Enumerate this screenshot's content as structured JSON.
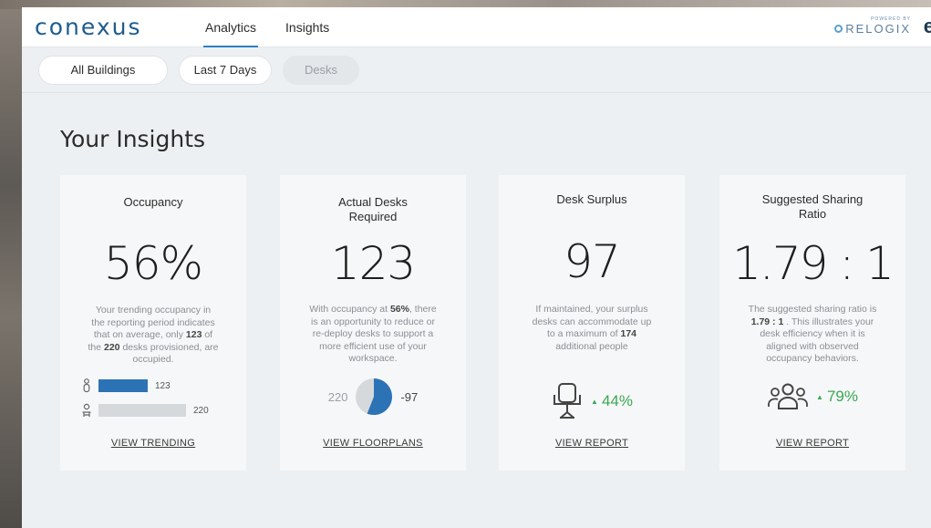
{
  "app": {
    "logo": "conexus",
    "nav": [
      {
        "label": "Analytics",
        "active": true
      },
      {
        "label": "Insights",
        "active": false
      }
    ],
    "powered_by": "POWERED BY",
    "brand": "RELOGIX",
    "edge_letter": "e"
  },
  "filters": [
    {
      "label": "All Buildings"
    },
    {
      "label": "Last 7 Days"
    },
    {
      "label": "Desks",
      "disabled": true
    }
  ],
  "page": {
    "title": "Your Insights"
  },
  "colors": {
    "accent": "#2f80c2",
    "bar_primary": "#2c73b6",
    "bar_secondary": "#d6d9dc",
    "positive": "#3aa853"
  },
  "cards": {
    "occupancy": {
      "title": "Occupancy",
      "value": "56%",
      "desc": [
        "Your trending occupancy in",
        "the reporting period indicates",
        "that on average, only ",
        "123",
        " of",
        "the ",
        "220",
        " desks provisioned, are",
        "occupied."
      ],
      "bars": [
        {
          "icon": "person-icon",
          "value": 123
        },
        {
          "icon": "desk-user-icon",
          "value": 220
        }
      ],
      "bar_max": 220,
      "link": "VIEW TRENDING"
    },
    "desks": {
      "title": [
        "Actual Desks",
        "Required"
      ],
      "value": "123",
      "desc": [
        "With occupancy at ",
        "56%",
        ", there",
        "is an opportunity to reduce or",
        "re-deploy desks to support a",
        "more efficient use of your",
        "workspace."
      ],
      "pie_left": "220",
      "pie_right": "-97",
      "pie_fraction": 0.56,
      "link": "VIEW FLOORPLANS"
    },
    "surplus": {
      "title": "Desk Surplus",
      "value": "97",
      "desc": [
        "If maintained, your surplus",
        "desks can accommodate up",
        "to a maximum of ",
        "174",
        "additional people"
      ],
      "icon": "office-chair-icon",
      "percent": "44%",
      "link": "VIEW REPORT"
    },
    "ratio": {
      "title": [
        "Suggested Sharing",
        "Ratio"
      ],
      "value": "1.79 : 1",
      "desc": [
        "The suggested sharing ratio is",
        "1.79 : 1",
        " . This illustrates your",
        "desk efficiency when it is",
        "aligned with observed",
        "occupancy behaviors."
      ],
      "icon": "people-group-icon",
      "percent": "79%",
      "link": "VIEW REPORT"
    }
  }
}
